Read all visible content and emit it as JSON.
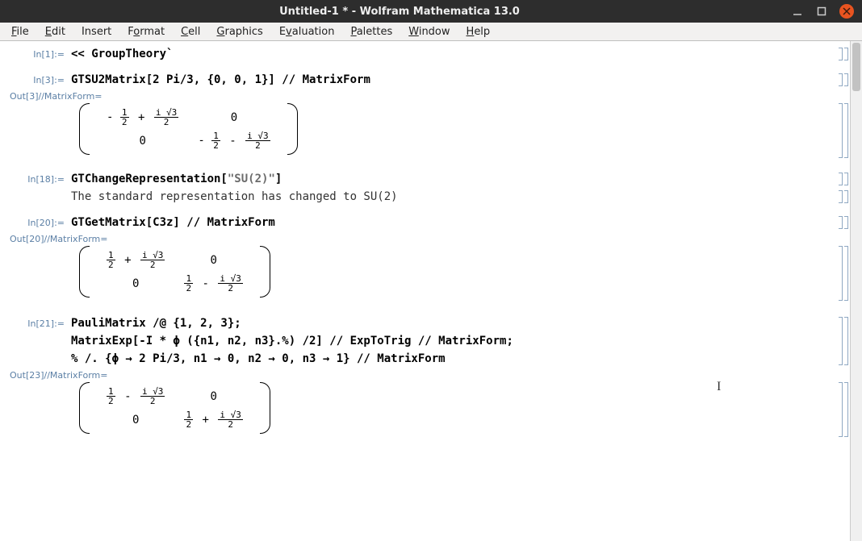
{
  "window": {
    "title": "Untitled-1 * - Wolfram Mathematica 13.0"
  },
  "menu": {
    "file": "File",
    "edit": "Edit",
    "insert": "Insert",
    "format": "Format",
    "cell": "Cell",
    "graphics": "Graphics",
    "evaluation": "Evaluation",
    "palettes": "Palettes",
    "window": "Window",
    "help": "Help"
  },
  "cells": {
    "in1": {
      "label": "In[1]:=",
      "code": "<< GroupTheory`"
    },
    "in3": {
      "label": "In[3]:=",
      "code_pre": "GTSU2Matrix",
      "code_args": "[2 Pi/3, {0, 0, 1}]",
      "code_post": " // MatrixForm"
    },
    "out3": {
      "label": "Out[3]//MatrixForm="
    },
    "in18": {
      "label": "In[18]:=",
      "code_pre": "GTChangeRepresentation[",
      "code_arg": "\"SU(2)\"",
      "code_post": "]"
    },
    "msg18": "The standard representation has changed to SU(2)",
    "in20": {
      "label": "In[20]:=",
      "code": "GTGetMatrix[C3z] // MatrixForm"
    },
    "out20": {
      "label": "Out[20]//MatrixForm="
    },
    "in21": {
      "label": "In[21]:=",
      "line1": "PauliMatrix /@ {1, 2, 3};",
      "line2": "MatrixExp[-I * ϕ ({n1, n2, n3}.%) /2] // ExpToTrig // MatrixForm;",
      "line3": "% /. {ϕ → 2 Pi/3, n1 → 0, n2 → 0, n3 → 1} // MatrixForm"
    },
    "out23": {
      "label": "Out[23]//MatrixForm="
    }
  },
  "matrices": {
    "m3": {
      "a11_sign": "-",
      "a11_op": "+",
      "a22_sign": "-",
      "a22_op": "-"
    },
    "m20": {
      "a11_sign": "",
      "a11_op": "+",
      "a22_sign": "",
      "a22_op": "-"
    },
    "m23": {
      "a11_sign": "",
      "a11_op": "-",
      "a22_sign": "",
      "a22_op": "+"
    }
  },
  "glyphs": {
    "zero": "0",
    "one": "1",
    "two": "2",
    "three": "3",
    "i": "i",
    "sqrt3": "√3"
  }
}
